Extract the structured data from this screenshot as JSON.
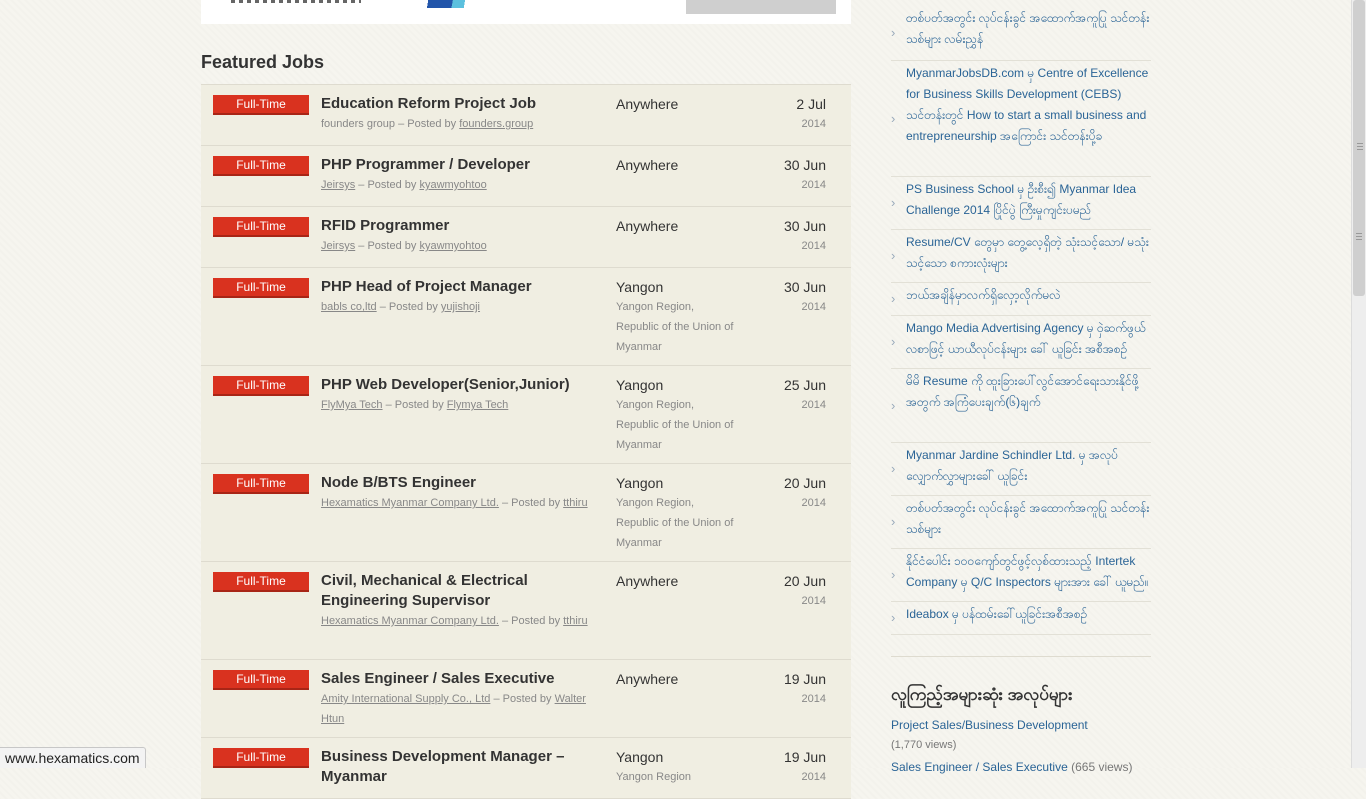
{
  "featured_title": "Featured Jobs",
  "jobs": [
    {
      "type": "Full-Time",
      "title": "Education Reform Project Job",
      "company": "founders group",
      "company_link": false,
      "posted_by_label": "– Posted by",
      "poster": "founders.group",
      "location": "Anywhere",
      "location_detail": "",
      "date": "2 Jul",
      "year": "2014"
    },
    {
      "type": "Full-Time",
      "title": "PHP Programmer / Developer",
      "company": "Jeirsys",
      "company_link": true,
      "posted_by_label": "– Posted by",
      "poster": "kyawmyohtoo",
      "location": "Anywhere",
      "location_detail": "",
      "date": "30 Jun",
      "year": "2014"
    },
    {
      "type": "Full-Time",
      "title": "RFID Programmer",
      "company": "Jeirsys",
      "company_link": true,
      "posted_by_label": "– Posted by",
      "poster": "kyawmyohtoo",
      "location": "Anywhere",
      "location_detail": "",
      "date": "30 Jun",
      "year": "2014"
    },
    {
      "type": "Full-Time",
      "title": "PHP Head of Project Manager",
      "company": "babls co,ltd",
      "company_link": true,
      "posted_by_label": "– Posted by",
      "poster": "yujishoji",
      "location": "Yangon",
      "location_detail": "Yangon Region, Republic of the Union of Myanmar",
      "date": "30 Jun",
      "year": "2014"
    },
    {
      "type": "Full-Time",
      "title": "PHP Web Developer(Senior,Junior)",
      "company": "FlyMya Tech",
      "company_link": true,
      "posted_by_label": "– Posted by",
      "poster": "Flymya Tech",
      "location": "Yangon",
      "location_detail": "Yangon Region, Republic of the Union of Myanmar",
      "date": "25 Jun",
      "year": "2014"
    },
    {
      "type": "Full-Time",
      "title": "Node B/BTS Engineer",
      "company": "Hexamatics Myanmar Company Ltd.",
      "company_link": true,
      "posted_by_label": "– Posted by",
      "poster": "tthiru",
      "location": "Yangon",
      "location_detail": "Yangon Region, Republic of the Union of Myanmar",
      "date": "20 Jun",
      "year": "2014"
    },
    {
      "type": "Full-Time",
      "title": "Civil, Mechanical & Electrical Engineering Supervisor",
      "company": "Hexamatics Myanmar Company Ltd.",
      "company_link": true,
      "posted_by_label": "– Posted by",
      "poster": "tthiru",
      "location": "Anywhere",
      "location_detail": "",
      "date": "20 Jun",
      "year": "2014"
    },
    {
      "type": "Full-Time",
      "title": "Sales Engineer / Sales Executive",
      "company": "Amity International Supply Co., Ltd",
      "company_link": true,
      "posted_by_label": "– Posted by",
      "poster": "Walter Htun",
      "location": "Anywhere",
      "location_detail": "",
      "date": "19 Jun",
      "year": "2014"
    },
    {
      "type": "Full-Time",
      "title": "Business Development Manager – Myanmar",
      "company": "",
      "company_link": true,
      "posted_by_label": "",
      "poster": "",
      "location": "Yangon",
      "location_detail": "Yangon Region",
      "date": "19 Jun",
      "year": "2014"
    }
  ],
  "sidebar": {
    "posts": [
      "တစ်ပတ်အတွင်း လုပ်ငန်းခွင် အထောက်အကူပြု သင်တန်းသစ်များ လမ်းညွှန်",
      "MyanmarJobsDB.com မှ Centre of Excellence for Business Skills Development (CEBS) သင်တန်းတွင် How to start a small business and entrepreneurship အကြောင်း သင်တန်းပို့ခ",
      "PS Business School မှ ဦးစီး၍ Myanmar Idea Challenge 2014 ပြိုင်ပွဲ ကြီးမှုကျင်းပမည်",
      "Resume/CV တွေမှာ တွေ့လေ့ရှိတဲ့ သုံးသင့်သော/ မသုံးသင့်သော စကားလုံးများ",
      "ဘယ်အချိန်မှာလက်ရှိလှော့လိုက်မလဲ",
      "Mango Media Advertising Agency မှ ဝှဲဆက်ဖွယ် လစာဖြင့် ယာယီလုပ်ငန်းများ ခေါ် ယူခြင်း အစီအစဉ်",
      "မိမိ Resume ကို ထူးခြားပေါ်လွင်အောင်ရေးသားနိုင်ဖို့အတွက် အကြံပေးချက်(၆)ချက်",
      "Myanmar Jardine Schindler Ltd. မှ အလုပ်လျှောက်လွှာများခေါ် ယူခြင်း",
      "တစ်ပတ်အတွင်း လုပ်ငန်းခွင် အထောက်အကူပြု သင်တန်းသစ်များ",
      "နိုင်ငံပေါင်း ၁၀၀ကျော်တွင်ဖွင့်လှစ်ထားသည့် Intertek Company မှ Q/C Inspectors များအား ခေါ် ယူမည်။",
      "Ideabox မှ ပန်ထမ်းခေါ်ယူခြင်းအစီအစဉ်"
    ],
    "popular_title": "လူကြည့်အများဆုံး အလုပ်များ",
    "popular": [
      {
        "title": "Project Sales/Business Development",
        "views": "(1,770 views)"
      },
      {
        "title": "Sales Engineer / Sales Executive",
        "views": "(665 views)"
      }
    ]
  },
  "status_url": "www.hexamatics.com",
  "colors": {
    "badge": "#d9321f",
    "link": "#2a6496",
    "row_bg": "#f0eee2"
  }
}
